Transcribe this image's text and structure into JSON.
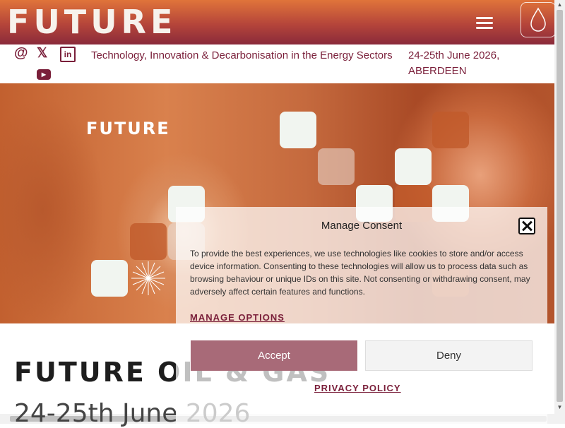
{
  "header": {
    "logo_letters": [
      "F",
      "U",
      "T",
      "U",
      "R",
      "E"
    ]
  },
  "social": {
    "email": "@",
    "twitter": "𝕏",
    "linkedin": "in",
    "youtube": "▶"
  },
  "subbar": {
    "tagline": "Technology, Innovation & Decarbonisation in the Energy Sectors",
    "dates": "24-25th June 2026, ABERDEEN"
  },
  "hero": {
    "logo": "FUTURE"
  },
  "main": {
    "headline": "FUTURE OIL & GAS",
    "subhead": "24-25th June 2026"
  },
  "consent": {
    "title": "Manage Consent",
    "body": "To provide the best experiences, we use technologies like cookies to store and/or access device information. Consenting to these technologies will allow us to process data such as browsing behaviour or unique IDs on this site. Not consenting or withdrawing consent, may adversely affect certain features and functions.",
    "manage_options": "MANAGE OPTIONS",
    "accept": "Accept",
    "deny": "Deny",
    "privacy_policy": "PRIVACY POLICY"
  },
  "colors": {
    "brand": "#7a1f3a",
    "header_top": "#e0743a",
    "header_bottom": "#8a2a3a",
    "accept_button": "#a86a78"
  },
  "icons": [
    "hamburger-menu-icon",
    "drop-icon",
    "at-icon",
    "x-twitter-icon",
    "linkedin-icon",
    "youtube-icon",
    "close-icon"
  ]
}
